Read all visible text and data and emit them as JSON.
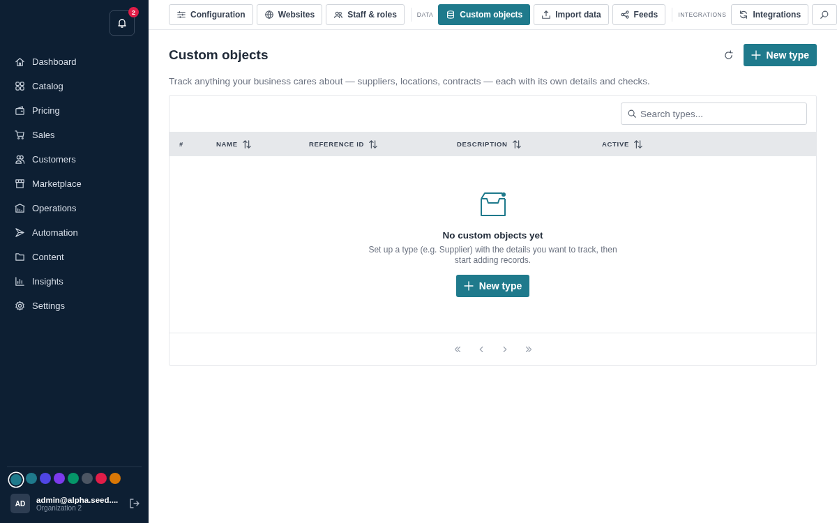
{
  "sidebar": {
    "notifications": {
      "count": "2"
    },
    "items": [
      {
        "label": "Dashboard",
        "selected": false
      },
      {
        "label": "Catalog",
        "selected": false
      },
      {
        "label": "Pricing",
        "selected": false
      },
      {
        "label": "Sales",
        "selected": false
      },
      {
        "label": "Customers",
        "selected": false
      },
      {
        "label": "Marketplace",
        "selected": false
      },
      {
        "label": "Operations",
        "selected": false
      },
      {
        "label": "Automation",
        "selected": false
      },
      {
        "label": "Content",
        "selected": false
      },
      {
        "label": "Insights",
        "selected": false
      },
      {
        "label": "Settings",
        "selected": false
      }
    ],
    "swatches": [
      {
        "color": "#1f7a8c",
        "selected": true
      },
      {
        "color": "#1f7a8c",
        "selected": false
      },
      {
        "color": "#4f46e5",
        "selected": false
      },
      {
        "color": "#7c3aed",
        "selected": false
      },
      {
        "color": "#059669",
        "selected": false
      },
      {
        "color": "#4b5563",
        "selected": false
      },
      {
        "color": "#e11d48",
        "selected": false
      },
      {
        "color": "#d97706",
        "selected": false
      }
    ],
    "user": {
      "initials": "AD",
      "email": "admin@alpha.seed....",
      "org": "Organization 2"
    }
  },
  "topbar": [
    {
      "kind": "button",
      "label": "Configuration",
      "selected": false
    },
    {
      "kind": "button",
      "label": "Websites",
      "selected": false
    },
    {
      "kind": "button",
      "label": "Staff & roles",
      "selected": false
    },
    {
      "kind": "section",
      "label": "DATA"
    },
    {
      "kind": "button",
      "label": "Custom objects",
      "selected": true
    },
    {
      "kind": "button",
      "label": "Import data",
      "selected": false
    },
    {
      "kind": "button",
      "label": "Feeds",
      "selected": false
    },
    {
      "kind": "section",
      "label": "INTEGRATIONS"
    },
    {
      "kind": "button",
      "label": "Integrations",
      "selected": false
    },
    {
      "kind": "button",
      "selected": false
    }
  ],
  "page": {
    "title": "Custom objects",
    "new_button": "New type",
    "description": "Track anything your business cares about — suppliers, locations, contracts — each with its own details and checks."
  },
  "table": {
    "search": {
      "placeholder": "Search types..."
    },
    "columns": [
      "#",
      "NAME",
      "REFERENCE ID",
      "DESCRIPTION",
      "ACTIVE"
    ],
    "empty": {
      "title": "No custom objects yet",
      "text": "Set up a type (e.g. Supplier) with the details you want to track, then start adding records.",
      "button": "New type"
    }
  }
}
